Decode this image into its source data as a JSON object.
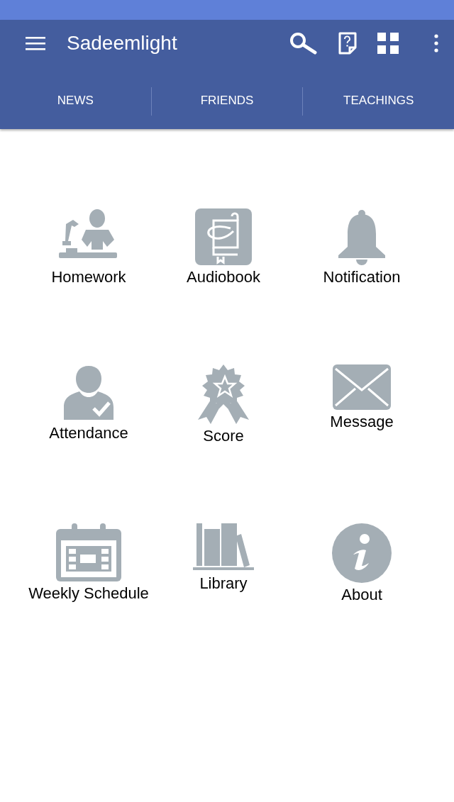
{
  "app_bar": {
    "title": "Sadeemlight"
  },
  "tabs": [
    {
      "label": "NEWS",
      "selected": false
    },
    {
      "label": "FRIENDS",
      "selected": false
    },
    {
      "label": "TEACHINGS",
      "selected": false
    }
  ],
  "tiles": [
    {
      "kind": "homework",
      "label": "Homework"
    },
    {
      "kind": "audiobook",
      "label": "Audiobook"
    },
    {
      "kind": "notification",
      "label": "Notification"
    },
    {
      "kind": "attendance",
      "label": "Attendance"
    },
    {
      "kind": "score",
      "label": "Score"
    },
    {
      "kind": "message",
      "label": "Message"
    },
    {
      "kind": "calendar",
      "label": "Weekly Schedule"
    },
    {
      "kind": "library",
      "label": "Library"
    },
    {
      "kind": "about",
      "label": "About"
    }
  ]
}
